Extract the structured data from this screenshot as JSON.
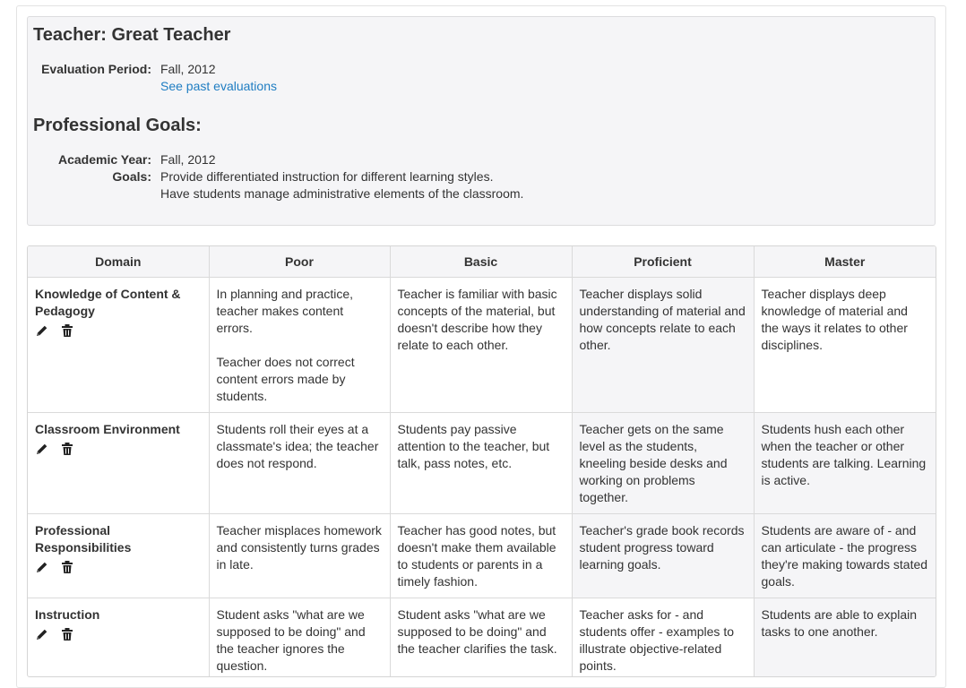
{
  "teacher_heading": "Teacher: Great Teacher",
  "evaluation": {
    "period_label": "Evaluation Period:",
    "period_value": "Fall, 2012",
    "past_link": "See past evaluations"
  },
  "goals_section": {
    "heading": "Professional Goals:",
    "year_label": "Academic Year:",
    "year_value": "Fall, 2012",
    "goals_label": "Goals:",
    "goals": [
      "Provide differentiated instruction for different learning styles.",
      "Have students manage administrative elements of the classroom."
    ]
  },
  "rubric": {
    "headers": [
      "Domain",
      "Poor",
      "Basic",
      "Proficient",
      "Master"
    ],
    "rows": [
      {
        "domain": "Knowledge of Content & Pedagogy",
        "poor": [
          "In planning and practice, teacher makes content errors.",
          "Teacher does not correct content errors made by students."
        ],
        "basic": [
          "Teacher is familiar with basic concepts of the material, but doesn't describe how they relate to each other."
        ],
        "proficient": [
          "Teacher displays solid understanding of material and how concepts relate to each other."
        ],
        "master": [
          "Teacher displays deep knowledge of material and the ways it relates to other disciplines."
        ]
      },
      {
        "domain": "Classroom Environment",
        "poor": [
          "Students roll their eyes at a classmate's idea; the teacher does not respond."
        ],
        "basic": [
          "Students pay passive attention to the teacher, but talk, pass notes, etc."
        ],
        "proficient": [
          "Teacher gets on the same level as the students, kneeling beside desks and working on problems together."
        ],
        "master": [
          "Students hush each other when the teacher or other students are talking. Learning is active."
        ]
      },
      {
        "domain": "Professional Responsibilities",
        "poor": [
          "Teacher misplaces homework and consistently turns grades in late."
        ],
        "basic": [
          "Teacher has good notes, but doesn't make them available to students or parents in a timely fashion."
        ],
        "proficient": [
          "Teacher's grade book records student progress toward learning goals."
        ],
        "master": [
          "Students are aware of - and can articulate - the progress they're making towards stated goals."
        ]
      },
      {
        "domain": "Instruction",
        "poor": [
          "Student asks \"what are we supposed to be doing\" and the teacher ignores the question."
        ],
        "basic": [
          "Student asks \"what are we supposed to be doing\" and the teacher clarifies the task."
        ],
        "proficient": [
          "Teacher asks for - and students offer - examples to illustrate objective-related points."
        ],
        "master": [
          "Students are able to explain tasks to one another."
        ]
      }
    ],
    "row_icons": [
      "pencil-icon",
      "trash-icon"
    ]
  }
}
